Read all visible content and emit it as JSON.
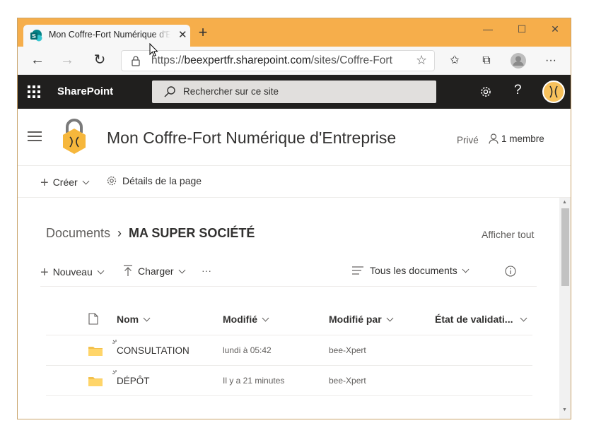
{
  "browser": {
    "tab_title": "Mon Coffre-Fort Numérique d'Entreprise",
    "url_prefix": "https://",
    "url_host": "beexpertfr.sharepoint.com",
    "url_path": "/sites/Coffre-Fort",
    "accent": "#f6ae4b"
  },
  "suitebar": {
    "app_name": "SharePoint",
    "search_placeholder": "Rechercher sur ce site",
    "help_label": "?"
  },
  "site": {
    "title": "Mon Coffre-Fort Numérique d'Entreprise",
    "privacy": "Privé",
    "members": "1 membre"
  },
  "commands": {
    "create": "Créer",
    "page_details": "Détails de la page"
  },
  "library": {
    "breadcrumb_root": "Documents",
    "breadcrumb_current": "MA SUPER SOCIÉTÉ",
    "see_all": "Afficher tout",
    "new": "Nouveau",
    "upload": "Charger",
    "more": "···",
    "view": "Tous les documents"
  },
  "table": {
    "columns": {
      "name": "Nom",
      "modified": "Modifié",
      "modified_by": "Modifié par",
      "approval": "État de validati..."
    },
    "rows": [
      {
        "name": "CONSULTATION",
        "modified": "lundi à 05:42",
        "modified_by": "bee-Xpert"
      },
      {
        "name": "DÉPÔT",
        "modified": "Il y a 21 minutes",
        "modified_by": "bee-Xpert"
      }
    ]
  }
}
